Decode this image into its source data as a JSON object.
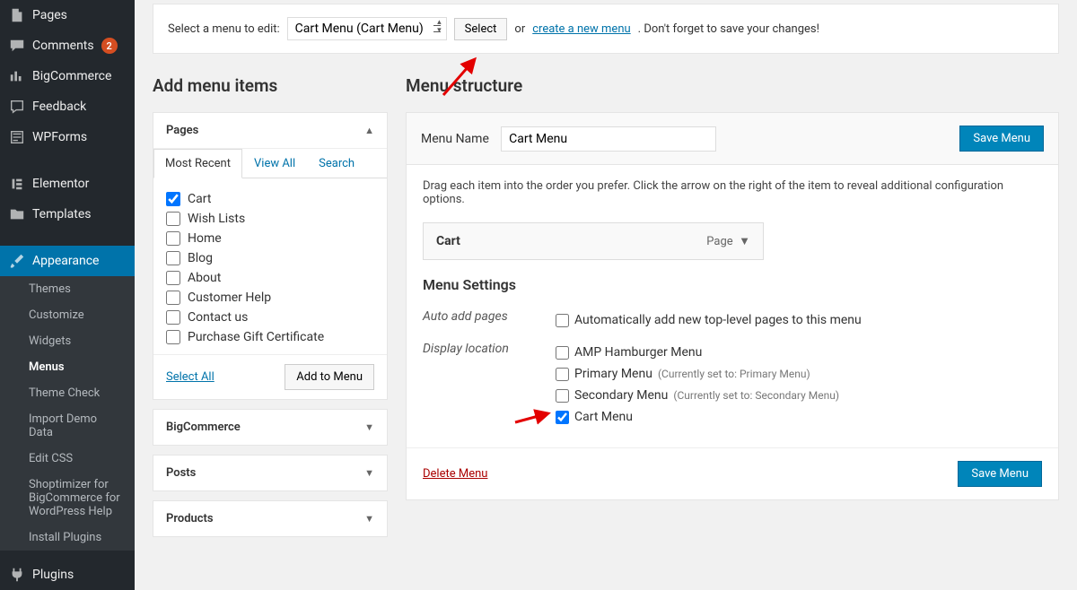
{
  "sidebar": {
    "items": [
      {
        "label": "Pages"
      },
      {
        "label": "Comments",
        "badge": "2"
      },
      {
        "label": "BigCommerce"
      },
      {
        "label": "Feedback"
      },
      {
        "label": "WPForms"
      },
      {
        "label": "Elementor"
      },
      {
        "label": "Templates"
      },
      {
        "label": "Appearance",
        "active": true
      },
      {
        "label": "Plugins"
      }
    ],
    "submenu": [
      {
        "label": "Themes"
      },
      {
        "label": "Customize"
      },
      {
        "label": "Widgets"
      },
      {
        "label": "Menus",
        "active": true
      },
      {
        "label": "Theme Check"
      },
      {
        "label": "Import Demo Data"
      },
      {
        "label": "Edit CSS"
      },
      {
        "label": "Shoptimizer for BigCommerce for WordPress Help"
      },
      {
        "label": "Install Plugins"
      }
    ]
  },
  "selectbar": {
    "prompt": "Select a menu to edit:",
    "selected": "Cart Menu (Cart Menu)",
    "select_btn": "Select",
    "or": "or",
    "create_link": "create a new menu",
    "reminder": ". Don't forget to save your changes!"
  },
  "left": {
    "heading": "Add menu items",
    "pages_title": "Pages",
    "tabs": {
      "recent": "Most Recent",
      "viewall": "View All",
      "search": "Search"
    },
    "pages": [
      {
        "label": "Cart",
        "checked": true
      },
      {
        "label": "Wish Lists"
      },
      {
        "label": "Home"
      },
      {
        "label": "Blog"
      },
      {
        "label": "About"
      },
      {
        "label": "Customer Help"
      },
      {
        "label": "Contact us"
      },
      {
        "label": "Purchase Gift Certificate"
      }
    ],
    "select_all": "Select All",
    "add_to_menu": "Add to Menu",
    "panels": [
      {
        "label": "BigCommerce"
      },
      {
        "label": "Posts"
      },
      {
        "label": "Products"
      }
    ]
  },
  "right": {
    "heading": "Menu structure",
    "menu_name_label": "Menu Name",
    "menu_name_value": "Cart Menu",
    "save_btn": "Save Menu",
    "instructions": "Drag each item into the order you prefer. Click the arrow on the right of the item to reveal additional configuration options.",
    "menu_item": {
      "name": "Cart",
      "type": "Page"
    },
    "settings_heading": "Menu Settings",
    "auto_add_label": "Auto add pages",
    "auto_add_text": "Automatically add new top-level pages to this menu",
    "display_label": "Display location",
    "locations": [
      {
        "label": "AMP Hamburger Menu",
        "checked": false,
        "note": ""
      },
      {
        "label": "Primary Menu",
        "checked": false,
        "note": "(Currently set to: Primary Menu)"
      },
      {
        "label": "Secondary Menu",
        "checked": false,
        "note": "(Currently set to: Secondary Menu)"
      },
      {
        "label": "Cart Menu",
        "checked": true,
        "note": ""
      }
    ],
    "delete_link": "Delete Menu"
  }
}
